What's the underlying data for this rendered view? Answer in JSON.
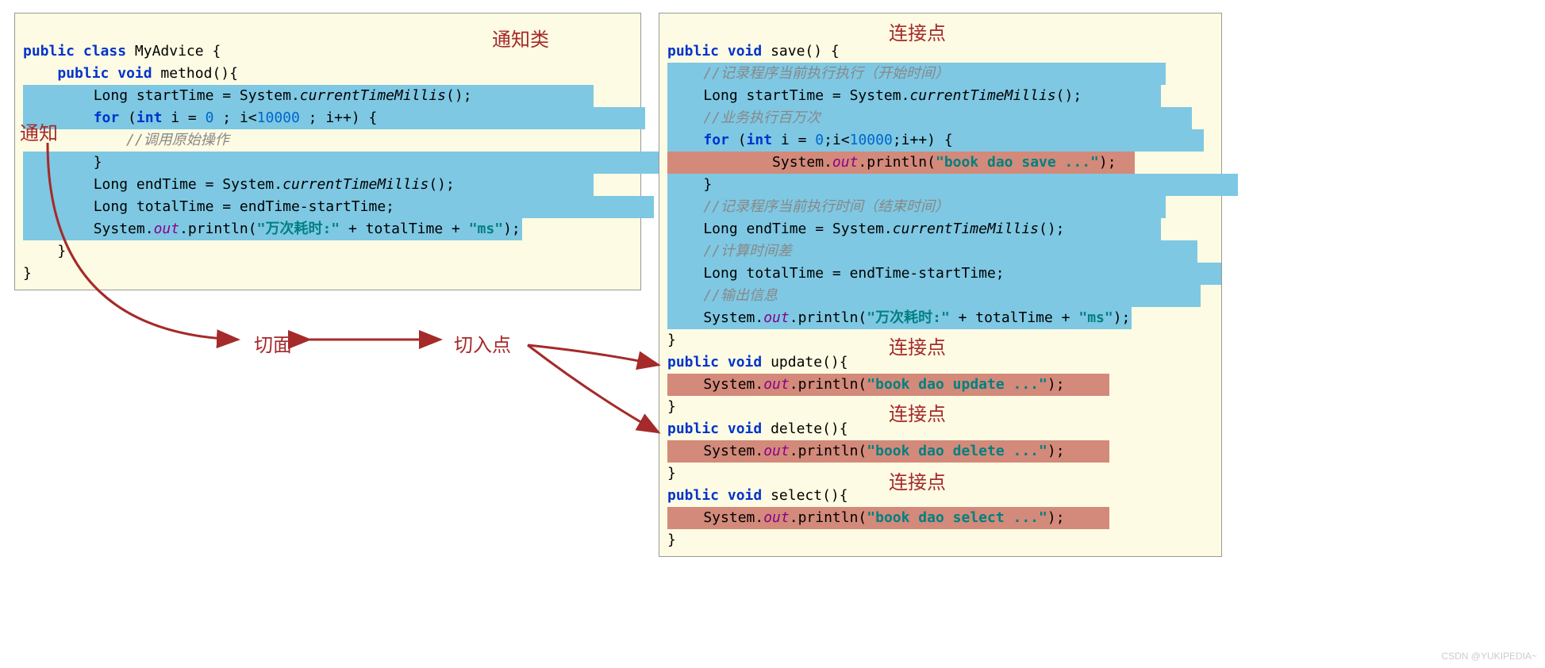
{
  "labels": {
    "advice_class": "通知类",
    "advice": "通知",
    "aspect": "切面",
    "pointcut": "切入点",
    "joinpoint": "连接点"
  },
  "left_code": {
    "l1_public": "public",
    "l1_class": "class",
    "l1_name": "MyAdvice",
    "l1_brace": " {",
    "l2_prefix": "    ",
    "l2_public": "public",
    "l2_void": " void ",
    "l2_method": "method",
    "l2_suffix": "(){",
    "l3": "        Long startTime = System.",
    "l3_ctm": "currentTimeMillis",
    "l3_end": "();",
    "l4_for": "for",
    "l4_int": "int",
    "l4_zero": "0",
    "l4_ten": "10000",
    "l4_template": "         ( i =  ; i< ; i++) {",
    "l5_comment": "            //调用原始操作",
    "l6": "        }",
    "l7": "        Long endTime = System.",
    "l7_end": "();",
    "l8": "        Long totalTime = endTime-startTime;",
    "l9a": "        System.",
    "l9_out": "out",
    "l9b": ".println(",
    "l9_str1": "\"万次耗时:\"",
    "l9c": " + totalTime + ",
    "l9_str2": "\"ms\"",
    "l9d": ");",
    "l10": "    }",
    "l11": "}"
  },
  "right_code": {
    "r1_public": "public",
    "r1_void": " void ",
    "r1_save": "save",
    "r1_suffix": "() {",
    "r2_comment": "    //记录程序当前执行执行（开始时间）",
    "r3": "    Long startTime = System.",
    "r3_ctm": "currentTimeMillis",
    "r3_end": "();",
    "r4_comment": "    //业务执行百万次",
    "r5_for": "for",
    "r5_int": "int",
    "r5_zero": "0",
    "r5_ten": "10000",
    "r5_line": "     ( i = ;i<;i++) {",
    "r6": "        System.",
    "r6_out": "out",
    "r6b": ".println(",
    "r6_str": "\"book dao save ...\"",
    "r6d": ");",
    "r7": "    }",
    "r8_comment": "    //记录程序当前执行时间（结束时间）",
    "r9": "    Long endTime = System.",
    "r9_end": "();",
    "r10_comment": "    //计算时间差",
    "r11": "    Long totalTime = endTime-startTime;",
    "r12_comment": "    //输出信息",
    "r13a": "    System.",
    "r13_out": "out",
    "r13b": ".println(",
    "r13_str1": "\"万次耗时:\"",
    "r13c": " + totalTime + ",
    "r13_str2": "\"ms\"",
    "r13d": ");",
    "r14": "}",
    "r15_public": "public",
    "r15_void": " void ",
    "r15_update": "update",
    "r15_suffix": "(){",
    "r16": "    System.",
    "r16_out": "out",
    "r16b": ".println(",
    "r16_str": "\"book dao update ...\"",
    "r16d": ");",
    "r17": "}",
    "r18_public": "public",
    "r18_delete": "delete",
    "r19": "    System.",
    "r19_str": "\"book dao delete ...\"",
    "r20": "}",
    "r21_public": "public",
    "r21_select": "select",
    "r22": "    System.",
    "r22_str": "\"book dao select ...\"",
    "r23": "}"
  },
  "watermark": "CSDN @YUKIPEDIA~"
}
